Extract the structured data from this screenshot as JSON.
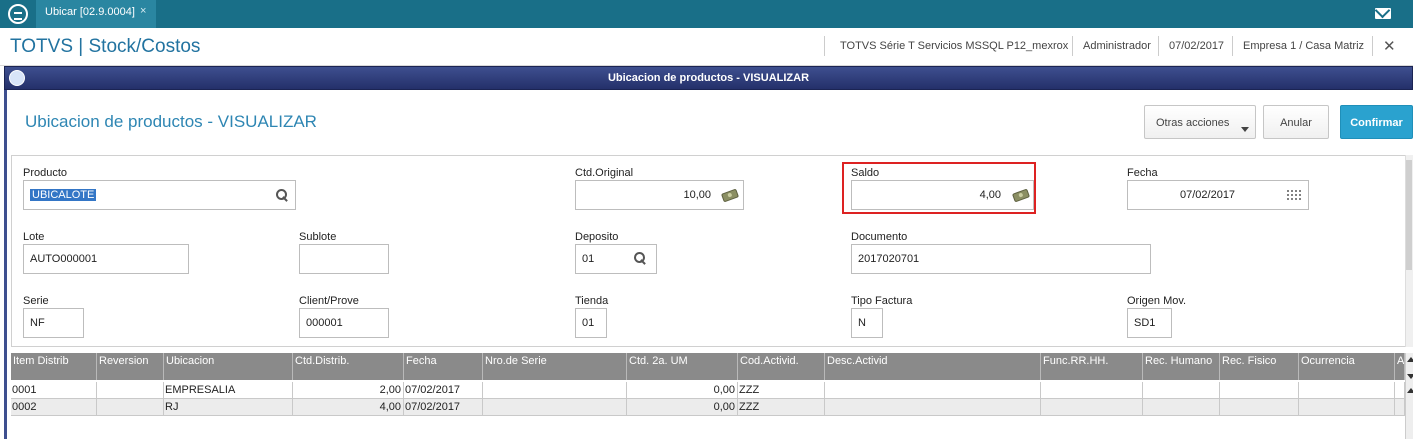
{
  "tabbar": {
    "tab_label": "Ubicar [02.9.0004]",
    "tab_close": "×"
  },
  "header": {
    "app_title": "TOTVS | Stock/Costos",
    "environment": "TOTVS Série T Servicios MSSQL P12_mexrox",
    "user": "Administrador",
    "date": "07/02/2017",
    "company": "Empresa 1 / Casa Matriz",
    "close": "✕"
  },
  "dialog": {
    "bar_title": "Ubicacion de productos - VISUALIZAR",
    "page_title": "Ubicacion de productos - VISUALIZAR",
    "buttons": {
      "more_actions": "Otras acciones",
      "cancel": "Anular",
      "confirm": "Confirmar"
    }
  },
  "form": {
    "producto": {
      "label": "Producto",
      "value": "UBICALOTE"
    },
    "ctd_original": {
      "label": "Ctd.Original",
      "value": "10,00"
    },
    "saldo": {
      "label": "Saldo",
      "value": "4,00"
    },
    "fecha": {
      "label": "Fecha",
      "value": "07/02/2017"
    },
    "lote": {
      "label": "Lote",
      "value": "AUTO000001"
    },
    "sublote": {
      "label": "Sublote",
      "value": ""
    },
    "deposito": {
      "label": "Deposito",
      "value": "01"
    },
    "documento": {
      "label": "Documento",
      "value": "2017020701"
    },
    "serie": {
      "label": "Serie",
      "value": "NF"
    },
    "client_prove": {
      "label": "Client/Prove",
      "value": "000001"
    },
    "tienda": {
      "label": "Tienda",
      "value": "01"
    },
    "tipo_factura": {
      "label": "Tipo Factura",
      "value": "N"
    },
    "origen_mov": {
      "label": "Origen Mov.",
      "value": "SD1"
    }
  },
  "grid": {
    "columns": [
      "Item Distrib",
      "Reversion",
      "Ubicacion",
      "Ctd.Distrib.",
      "Fecha",
      "Nro.de Serie",
      "Ctd. 2a. UM",
      "Cod.Activid.",
      "Desc.Activid",
      "Func.RR.HH.",
      "Rec. Humano",
      "Rec. Fisico",
      "Ocurrencia",
      "A"
    ],
    "rows": [
      [
        "0001",
        "",
        "EMPRESALIA",
        "2,00",
        "07/02/2017",
        "",
        "0,00",
        "ZZZ",
        "",
        "",
        "",
        "",
        "",
        ""
      ],
      [
        "0002",
        "",
        "RJ",
        "4,00",
        "07/02/2017",
        "",
        "0,00",
        "ZZZ",
        "",
        "",
        "",
        "",
        "",
        ""
      ]
    ]
  },
  "colors": {
    "topbar": "#196f88",
    "accent": "#2e86b3",
    "confirm_button": "#2aa2cf",
    "highlight_box": "#dd2222"
  },
  "icons": [
    "app-logo-icon",
    "mail-icon",
    "search-icon",
    "money-icon",
    "calendar-icon",
    "dialog-icon"
  ]
}
